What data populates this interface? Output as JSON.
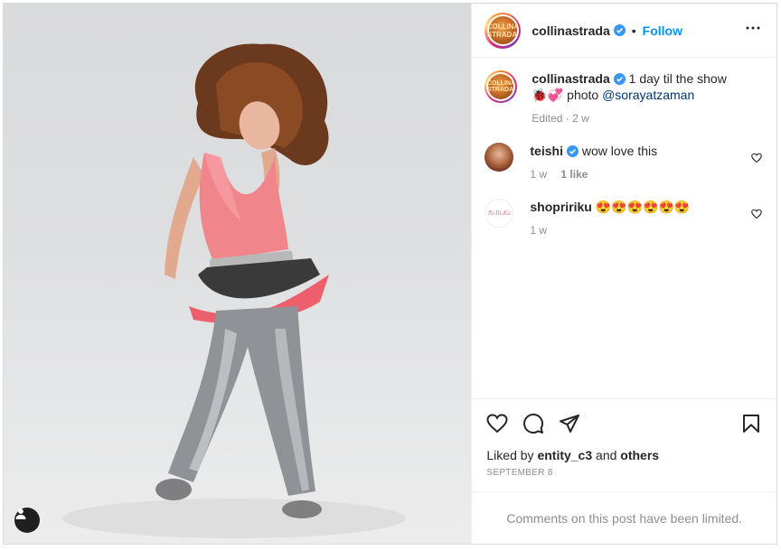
{
  "post": {
    "author": "collinastrada",
    "avatar_text": "COLLINA STRADA",
    "follow_label": "Follow",
    "separator": "•",
    "more_icon": "more-horizontal-icon",
    "colors": {
      "accent": "#0095f6",
      "verified": "#3897f0",
      "text": "#262626",
      "muted": "#8e8e8e"
    }
  },
  "caption": {
    "user": "collinastrada",
    "text_1": "1 day til the show",
    "emoji": "🐞💞",
    "text_2": "photo",
    "mention": "@sorayatzaman",
    "edited": "Edited",
    "time": "2 w"
  },
  "comments": [
    {
      "user": "teishi",
      "verified": true,
      "text": "wow love this",
      "time": "1 w",
      "likes": "1 like"
    },
    {
      "user": "shopririku",
      "verified": false,
      "text": "😍😍😍😍😍😍",
      "time": "1 w",
      "avatar_text": "Ri-Ri-Ku"
    }
  ],
  "actions": {
    "like_icon": "heart-icon",
    "comment_icon": "comment-icon",
    "share_icon": "paper-plane-icon",
    "save_icon": "bookmark-icon"
  },
  "likes": {
    "prefix": "Liked by",
    "user": "entity_c3",
    "and": "and",
    "others": "others"
  },
  "date": "SEPTEMBER 8",
  "limited_notice": "Comments on this post have been limited."
}
